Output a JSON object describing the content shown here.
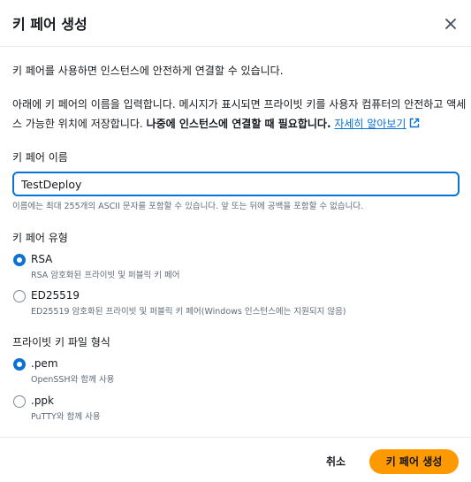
{
  "dialog": {
    "title": "키 페어 생성",
    "intro": "키 페어를 사용하면 인스턴스에 안전하게 연결할 수 있습니다.",
    "desc_line1": "아래에 키 페어의 이름을 입력합니다. 메시지가 표시되면 프라이빗 키를 사용자 컴퓨터의 안전하고 액세",
    "desc_line2_prefix": "스 가능한 위치에 저장합니다. ",
    "desc_line2_bold": "나중에 인스턴스에 연결할 때 필요합니다.",
    "learn_more": "자세히 알아보기"
  },
  "name_field": {
    "label": "키 페어 이름",
    "value": "TestDeploy",
    "hint": "이름에는 최대 255개의 ASCII 문자를 포함할 수 있습니다. 앞 또는 뒤에 공백을 포함할 수 없습니다."
  },
  "key_type": {
    "label": "키 페어 유형",
    "options": [
      {
        "label": "RSA",
        "desc": "RSA 암호화된 프라이빗 및 퍼블릭 키 페어",
        "selected": true
      },
      {
        "label": "ED25519",
        "desc": "ED25519 암호화된 프라이빗 및 퍼블릭 키 페어(Windows 인스턴스에는 지원되지 않음)",
        "selected": false
      }
    ]
  },
  "file_format": {
    "label": "프라이빗 키 파일 형식",
    "options": [
      {
        "label": ".pem",
        "desc": "OpenSSH와 함께 사용",
        "selected": true
      },
      {
        "label": ".ppk",
        "desc": "PuTTY와 함께 사용",
        "selected": false
      }
    ]
  },
  "footer": {
    "cancel_label": "취소",
    "create_label": "키 페어 생성"
  },
  "colors": {
    "accent": "#0972d3",
    "primary_button": "#ff9900"
  }
}
